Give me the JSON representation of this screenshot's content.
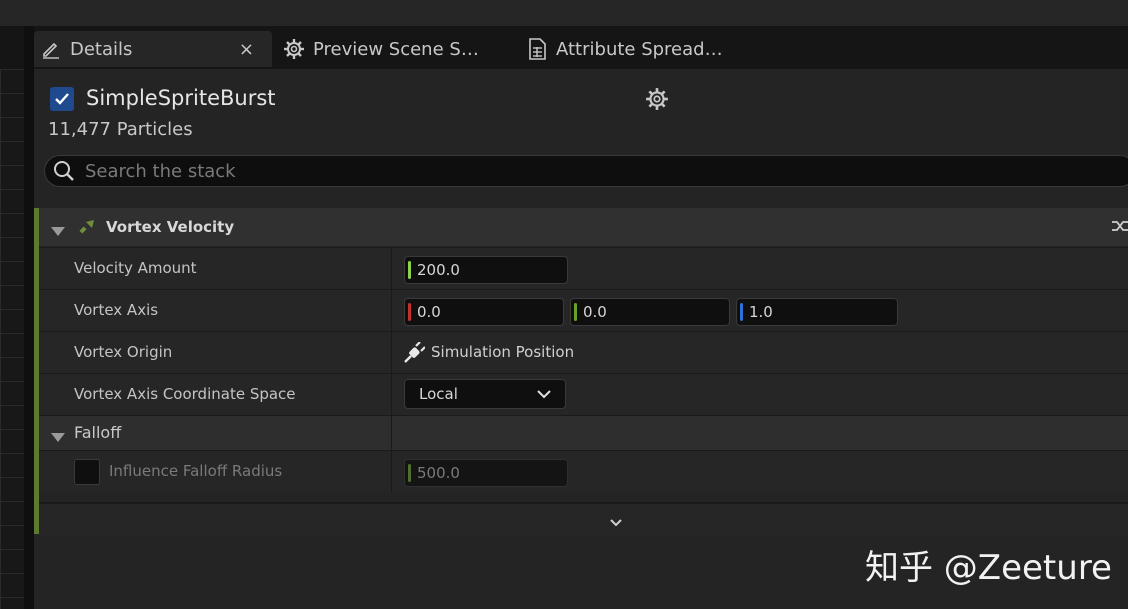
{
  "tabs": [
    {
      "label": "Details",
      "icon": "pencil-icon",
      "active": true,
      "close": "×"
    },
    {
      "label": "Preview Scene S…",
      "icon": "gear-icon"
    },
    {
      "label": "Attribute Spread…",
      "icon": "spreadsheet-icon"
    }
  ],
  "emitter": {
    "name": "SimpleSpriteBurst",
    "enabled": true,
    "particles": "11,477 Particles"
  },
  "search": {
    "placeholder": "Search the stack"
  },
  "module": {
    "title": "Vortex Velocity",
    "accent_color": "#5e7a2e",
    "rows": {
      "velocity_amount": {
        "label": "Velocity Amount",
        "value": "200.0"
      },
      "vortex_axis": {
        "label": "Vortex Axis",
        "x": "0.0",
        "y": "0.0",
        "z": "1.0"
      },
      "vortex_origin": {
        "label": "Vortex Origin",
        "value": "Simulation Position"
      },
      "coord_space": {
        "label": "Vortex Axis Coordinate Space",
        "value": "Local"
      },
      "falloff": {
        "label": "Falloff"
      },
      "influence": {
        "label": "Influence Falloff Radius",
        "value": "500.0",
        "enabled": false
      }
    }
  },
  "colors": {
    "x_axis": "#c23030",
    "y_axis": "#6aa02a",
    "z_axis": "#2f6fd6",
    "float": "#8ed14a"
  },
  "watermark": "知乎 @Zeeture"
}
